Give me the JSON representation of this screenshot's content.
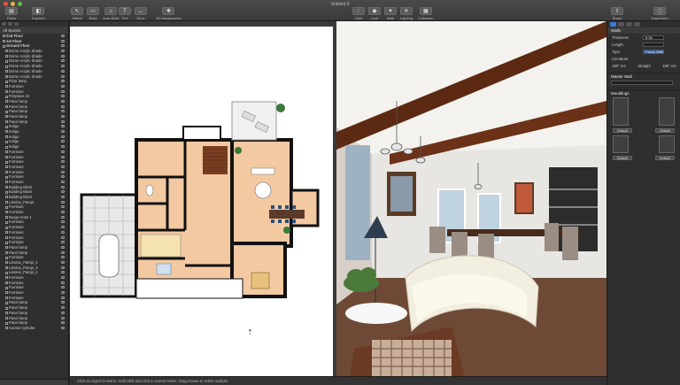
{
  "window": {
    "title": "Untitled 8"
  },
  "toolbar": {
    "items": [
      {
        "label": "Plans",
        "icon": "plans-icon",
        "glyph": "▤"
      },
      {
        "label": "Explorer",
        "icon": "explorer-icon",
        "glyph": "◧"
      },
      {
        "label": "Select",
        "icon": "select-icon",
        "glyph": "↖"
      },
      {
        "label": "Build",
        "icon": "build-icon",
        "glyph": "▭"
      },
      {
        "label": "Auto-Build",
        "icon": "autobuild-icon",
        "glyph": "⌂"
      },
      {
        "label": "Text",
        "icon": "text-icon",
        "glyph": "T"
      },
      {
        "label": "Dims",
        "icon": "dimensions-icon",
        "glyph": "↔"
      },
      {
        "label": "2D Manipulation",
        "icon": "manipulation-icon",
        "glyph": "✥"
      },
      {
        "label": "Orbit",
        "icon": "orbit-icon",
        "glyph": "◌"
      },
      {
        "label": "Look",
        "icon": "look-icon",
        "glyph": "◉"
      },
      {
        "label": "Walk",
        "icon": "walk-icon",
        "glyph": "✦"
      },
      {
        "label": "Lighting",
        "icon": "lighting-icon",
        "glyph": "☀"
      },
      {
        "label": "Collection",
        "icon": "collection-icon",
        "glyph": "▦"
      },
      {
        "label": "Share",
        "icon": "share-icon",
        "glyph": "⇪"
      },
      {
        "label": "Inspectors",
        "icon": "inspectors-icon",
        "glyph": "ⓘ"
      }
    ]
  },
  "sidebar": {
    "header": "All Stories",
    "rows": [
      {
        "label": "2nd Floor",
        "level": 0
      },
      {
        "label": "1st Floor",
        "level": 0
      },
      {
        "label": "Ground Floor",
        "level": 0
      },
      {
        "label": "Dome Acrylic Shade",
        "level": 1
      },
      {
        "label": "Dome Acrylic Shade",
        "level": 1
      },
      {
        "label": "Dome Acrylic Shade",
        "level": 1
      },
      {
        "label": "Dome Acrylic Shade",
        "level": 1
      },
      {
        "label": "Dome Acrylic Shade",
        "level": 1
      },
      {
        "label": "Dome Acrylic Shade",
        "level": 1
      },
      {
        "label": "Floor lamp",
        "level": 1
      },
      {
        "label": "Furniture",
        "level": 1
      },
      {
        "label": "Furniture",
        "level": 1
      },
      {
        "label": "Fireplace 42",
        "level": 1
      },
      {
        "label": "Panel lamp",
        "level": 1
      },
      {
        "label": "Panel lamp",
        "level": 1
      },
      {
        "label": "Panel lamp",
        "level": 1
      },
      {
        "label": "Panel lamp",
        "level": 1
      },
      {
        "label": "Panel lamp",
        "level": 1
      },
      {
        "label": "Indigo",
        "level": 1
      },
      {
        "label": "Indigo",
        "level": 1
      },
      {
        "label": "Indigo",
        "level": 1
      },
      {
        "label": "Indigo",
        "level": 1
      },
      {
        "label": "Indigo",
        "level": 1
      },
      {
        "label": "Furniture",
        "level": 1
      },
      {
        "label": "Furniture",
        "level": 1
      },
      {
        "label": "Furniture",
        "level": 1
      },
      {
        "label": "Furniture",
        "level": 1
      },
      {
        "label": "Furniture",
        "level": 1
      },
      {
        "label": "Furniture",
        "level": 1
      },
      {
        "label": "Furniture",
        "level": 1
      },
      {
        "label": "Building Block",
        "level": 1
      },
      {
        "label": "Building Block",
        "level": 1
      },
      {
        "label": "Building Block",
        "level": 1
      },
      {
        "label": "Lámina_Pampi",
        "level": 1
      },
      {
        "label": "Furniture",
        "level": 1
      },
      {
        "label": "Furniture",
        "level": 1
      },
      {
        "label": "Burge Hotel 1",
        "level": 1
      },
      {
        "label": "Furniture",
        "level": 1
      },
      {
        "label": "Furniture",
        "level": 1
      },
      {
        "label": "Furniture",
        "level": 1
      },
      {
        "label": "Furniture",
        "level": 1
      },
      {
        "label": "Furniture",
        "level": 1
      },
      {
        "label": "Panel lamp",
        "level": 1
      },
      {
        "label": "Panel lamp",
        "level": 1
      },
      {
        "label": "Furniture",
        "level": 1
      },
      {
        "label": "Lámina_Pampi_2",
        "level": 1
      },
      {
        "label": "Lámina_Pampi_3",
        "level": 1
      },
      {
        "label": "Lámina_Pampi_4",
        "level": 1
      },
      {
        "label": "Furniture",
        "level": 1
      },
      {
        "label": "Furniture",
        "level": 1
      },
      {
        "label": "Furniture",
        "level": 1
      },
      {
        "label": "Furniture",
        "level": 1
      },
      {
        "label": "Furniture",
        "level": 1
      },
      {
        "label": "Panel lamp",
        "level": 1
      },
      {
        "label": "Panel lamp",
        "level": 1
      },
      {
        "label": "Panel lamp",
        "level": 1
      },
      {
        "label": "Panel lamp",
        "level": 1
      },
      {
        "label": "Panel lamp",
        "level": 1
      },
      {
        "label": "Cactus Cylinder",
        "level": 1
      }
    ]
  },
  "plan": {
    "room_labels": [
      "",
      "",
      "",
      "",
      "",
      "",
      ""
    ]
  },
  "status": {
    "text": "Click an object to select. Hold Shift and click to extend select. Drag mouse to select multiple."
  },
  "inspector": {
    "header": "Walls",
    "thickness_label": "Thickness",
    "thickness_value": "0.30",
    "length_label": "Length",
    "length_value": "",
    "type_label": "Type",
    "type_value": "Fancy Wall",
    "curvature_label": "Curvature",
    "curve_options": [
      "180° Arc",
      "Straight",
      "180° Arc"
    ],
    "master_label": "Master Wall",
    "mouldings_label": "Mouldings",
    "default_label": "Default"
  },
  "colors": {
    "accent": "#3b7bd4",
    "floor": "#f3c9a2",
    "wall": "#111111"
  }
}
